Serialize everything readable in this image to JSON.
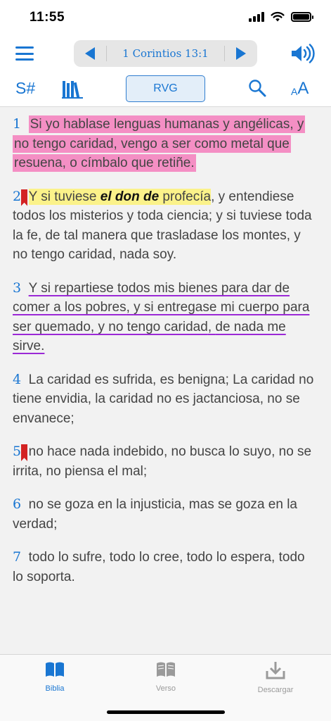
{
  "status_bar": {
    "time": "11:55"
  },
  "nav": {
    "book_title": "1 Corintios 13:1"
  },
  "toolbar": {
    "strongs_label": "S#",
    "version_label": "RVG",
    "font_small": "A",
    "font_large": "A"
  },
  "colors": {
    "accent": "#1976d2",
    "pink_highlight": "#f48fc4",
    "yellow_highlight": "#fbf28a",
    "purple_underline": "#9b29d6",
    "bookmark": "#d32222"
  },
  "verses": [
    {
      "num": "1",
      "text": "Si yo hablase lenguas humanas y angélicas, y no tengo caridad, vengo a ser como metal que resuena, o címbalo que retiñe."
    },
    {
      "num": "2",
      "bookmarked": true,
      "hl_before": "Y si tuviese ",
      "hl_em": "el don de",
      "hl_after": " profecía",
      "rest": ", y entendiese todos los misterios y toda ciencia; y si tuviese toda la fe, de tal manera que trasladase los montes, y no tengo caridad, nada soy."
    },
    {
      "num": "3",
      "segments": [
        "Y si repartiese todos mis bienes para dar de comer a los pobres",
        ", ",
        "y si entregase mi cuerpo para ser quemado",
        ", ",
        "y no tengo caridad",
        ", ",
        "de nada me sirve."
      ]
    },
    {
      "num": "4",
      "text": "La caridad es sufrida, es benigna; La caridad no tiene envidia, la caridad no es jactanciosa, no se envanece;"
    },
    {
      "num": "5",
      "bookmarked": true,
      "text": "no hace nada indebido, no busca lo suyo, no se irrita, no piensa el mal;"
    },
    {
      "num": "6",
      "text": "no se goza en la injusticia, mas se goza en la verdad;"
    },
    {
      "num": "7",
      "text": "todo lo sufre, todo lo cree, todo lo espera, todo lo soporta."
    }
  ],
  "tabs": [
    {
      "label": "Biblia",
      "icon": "open-book-icon",
      "active": true
    },
    {
      "label": "Verso",
      "icon": "verse-book-icon",
      "active": false
    },
    {
      "label": "Descargar",
      "icon": "download-icon",
      "active": false
    }
  ]
}
